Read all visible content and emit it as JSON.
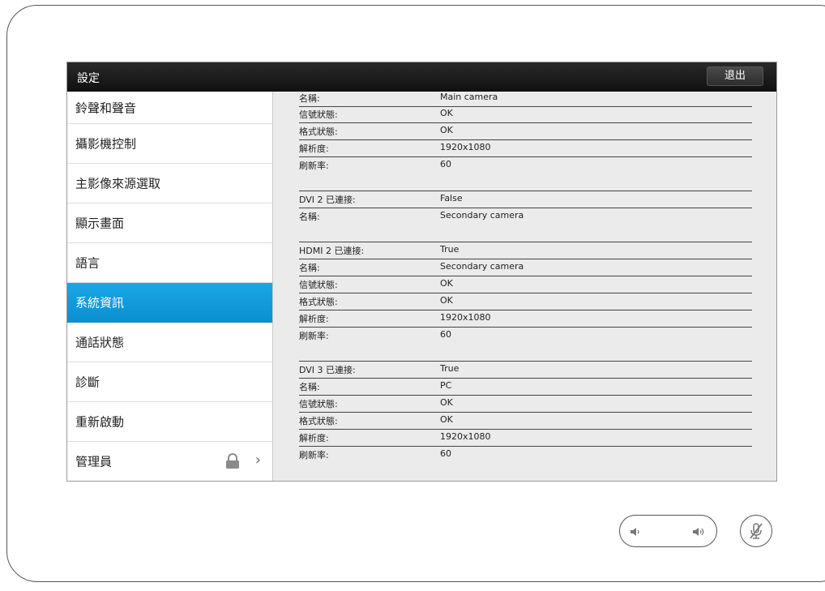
{
  "header": {
    "title": "設定",
    "exit_label": "退出"
  },
  "sidebar": {
    "items": [
      {
        "label": "鈴聲和聲音"
      },
      {
        "label": "攝影機控制"
      },
      {
        "label": "主影像來源選取"
      },
      {
        "label": "顯示畫面"
      },
      {
        "label": "語言"
      },
      {
        "label": "系統資訊"
      },
      {
        "label": "通話狀態"
      },
      {
        "label": "診斷"
      },
      {
        "label": "重新啟動"
      },
      {
        "label": "管理員"
      }
    ]
  },
  "content": {
    "rows": [
      {
        "key": "名稱:",
        "value": "Main camera"
      },
      {
        "key": "信號狀態:",
        "value": "OK"
      },
      {
        "key": "格式狀態:",
        "value": "OK"
      },
      {
        "key": "解析度:",
        "value": "1920x1080"
      },
      {
        "key": "刷新率:",
        "value": "60"
      },
      {
        "key": "DVI 2 已連接:",
        "value": "False"
      },
      {
        "key": "名稱:",
        "value": "Secondary camera"
      },
      {
        "key": "HDMI 2 已連接:",
        "value": "True"
      },
      {
        "key": "名稱:",
        "value": "Secondary camera"
      },
      {
        "key": "信號狀態:",
        "value": "OK"
      },
      {
        "key": "格式狀態:",
        "value": "OK"
      },
      {
        "key": "解析度:",
        "value": "1920x1080"
      },
      {
        "key": "刷新率:",
        "value": "60"
      },
      {
        "key": "DVI 3 已連接:",
        "value": "True"
      },
      {
        "key": "名稱:",
        "value": "PC"
      },
      {
        "key": "信號狀態:",
        "value": "OK"
      },
      {
        "key": "格式狀態:",
        "value": "OK"
      },
      {
        "key": "解析度:",
        "value": "1920x1080"
      },
      {
        "key": "刷新率:",
        "value": "60"
      }
    ]
  },
  "icons": {
    "lock": "lock-icon",
    "chevron": "chevron-right-icon",
    "volume_down": "volume-down-icon",
    "volume_up": "volume-up-icon",
    "mic_mute": "microphone-muted-icon"
  },
  "colors": {
    "accent": "#0b9ad8",
    "titlebar": "#1a1a1a"
  }
}
